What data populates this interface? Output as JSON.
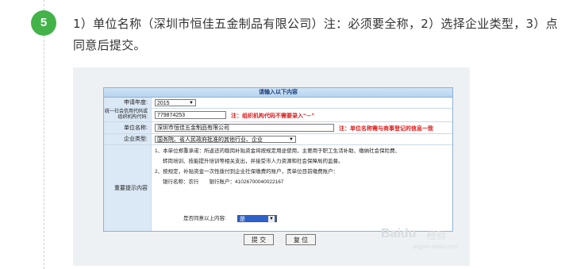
{
  "step": {
    "number": "5",
    "text": "1）单位名称（深圳市恒佳五金制品有限公司）注：必须要全称，2）选择企业类型，3）点同意后提交。"
  },
  "form": {
    "title": "请输入以下内容",
    "year": {
      "label": "申请年度:",
      "value": "2015"
    },
    "code": {
      "label": "统一社会信用代码或组织机构代码:",
      "value": "779874253",
      "note": "注：组织机构代码不需要录入“－”"
    },
    "name": {
      "label": "单位名称:",
      "value": "深圳市恒佳五金制品有限公司",
      "note": "注：单位名称需与商事登记的信息一致"
    },
    "type": {
      "label": "企业类型:",
      "value": "国务院、省人民政府批准的其他行业、企业"
    },
    "notice": {
      "label": "重要提示内容",
      "lines": [
        "1、本单位郑重承诺：所返还的稳岗补贴资金将按规定用途使用，主要用于职工生活补助、缴纳社会保险费、",
        "转岗培训、技能提升培训等相关支出，并接受市人力资源和社会保障局的监督。",
        "2、按规定，补贴资金一次性拨付到企业社保缴费的账户，贵单位目前缴费账户：",
        "银行名称：农行　　银行账户：41026700040022167"
      ],
      "agree_label": "是否同意以上内容:",
      "agree_value": "是"
    },
    "submit_label": "提 交",
    "reset_label": "复 位"
  },
  "watermark": {
    "text": "Baidu",
    "subtext": "经验",
    "url": "jingyan.baidu.com"
  }
}
